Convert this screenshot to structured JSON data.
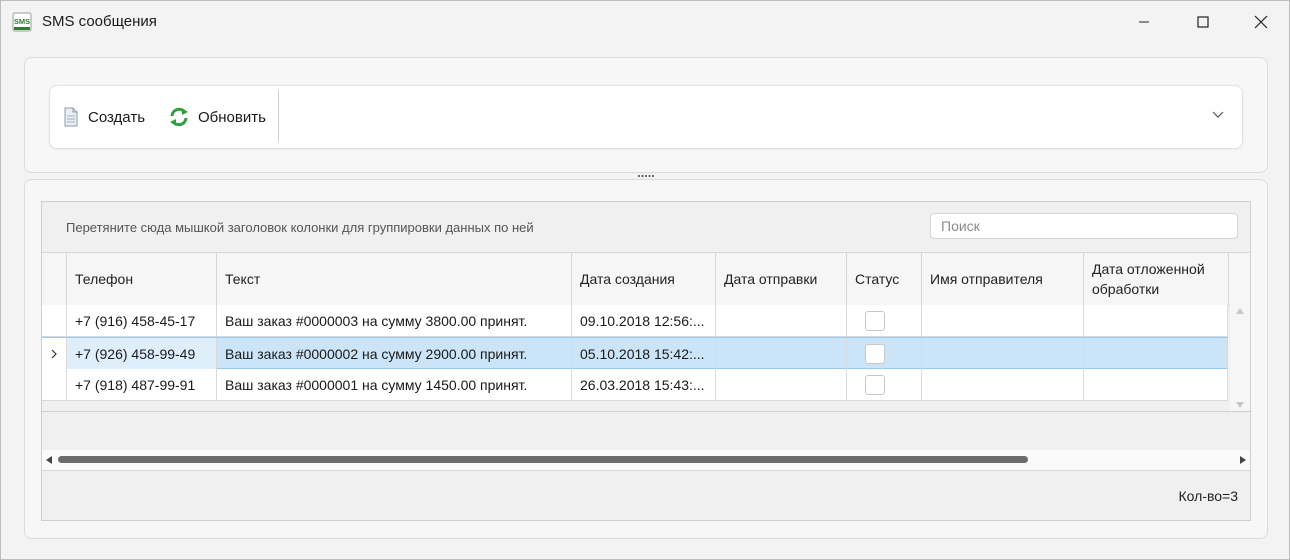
{
  "window": {
    "title": "SMS сообщения",
    "app_icon_text": "SMS"
  },
  "toolbar": {
    "create_label": "Создать",
    "refresh_label": "Обновить"
  },
  "grid": {
    "group_hint": "Перетяните сюда мышкой заголовок колонки для группировки данных по ней",
    "search_placeholder": "Поиск",
    "columns": [
      "Телефон",
      "Текст",
      "Дата создания",
      "Дата отправки",
      "Статус",
      "Имя отправителя",
      "Дата отложенной обработки"
    ],
    "rows": [
      {
        "phone": "+7 (916) 458-45-17",
        "text": "Ваш заказ #0000003 на сумму 3800.00 принят.",
        "created": "09.10.2018 12:56:...",
        "sent": "",
        "status": false,
        "sender": "",
        "deferred": ""
      },
      {
        "phone": "+7 (926) 458-99-49",
        "text": "Ваш заказ #0000002 на сумму 2900.00 принят.",
        "created": "05.10.2018 15:42:...",
        "sent": "",
        "status": false,
        "sender": "",
        "deferred": ""
      },
      {
        "phone": "+7 (918) 487-99-91",
        "text": "Ваш заказ #0000001 на сумму 1450.00 принят.",
        "created": "26.03.2018 15:43:...",
        "sent": "",
        "status": false,
        "sender": "",
        "deferred": ""
      }
    ],
    "selected_row": 2,
    "count_label": "Кол-во=3"
  },
  "colors": {
    "selection": "#cce4f7",
    "refresh_icon": "#2e9e3e",
    "app_icon": "#2e7d32"
  }
}
